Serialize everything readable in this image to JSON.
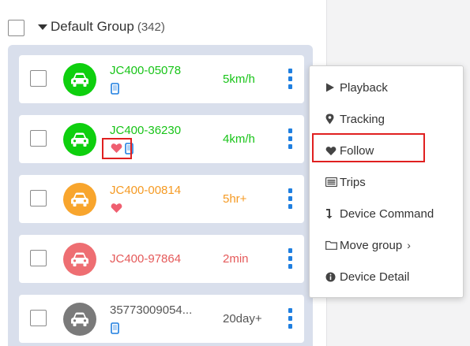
{
  "group": {
    "name": "Default Group",
    "count": "(342)"
  },
  "devices": [
    {
      "name": "JC400-05078",
      "status": "5km/h",
      "color": "#18c418",
      "avatar_color": "#0ecf0e",
      "icons": [
        "phone-icon"
      ]
    },
    {
      "name": "JC400-36230",
      "status": "4km/h",
      "color": "#18c418",
      "avatar_color": "#0ecf0e",
      "icons": [
        "heart-icon",
        "phone-icon"
      ]
    },
    {
      "name": "JC400-00814",
      "status": "5hr+",
      "color": "#f59a23",
      "avatar_color": "#f8a52d",
      "icons": [
        "heart-icon"
      ]
    },
    {
      "name": "JC400-97864",
      "status": "2min",
      "color": "#e55a5a",
      "avatar_color": "#ee6e72",
      "icons": []
    },
    {
      "name": "35773009054...",
      "status": "20day+",
      "color": "#555555",
      "avatar_color": "#7a7a7a",
      "icons": [
        "phone-icon"
      ]
    }
  ],
  "menu": {
    "items": [
      {
        "label": "Playback",
        "icon": "play-icon"
      },
      {
        "label": "Tracking",
        "icon": "map-marker-icon"
      },
      {
        "label": "Follow",
        "icon": "heart-icon"
      },
      {
        "label": "Trips",
        "icon": "list-icon"
      },
      {
        "label": "Device Command",
        "icon": "command-arrow-icon"
      },
      {
        "label": "Move group",
        "icon": "folder-icon",
        "submenu": "›"
      },
      {
        "label": "Device Detail",
        "icon": "info-circle-icon"
      }
    ]
  },
  "colors": {
    "accent_blue": "#1f7fe0",
    "heart": "#ef5f70",
    "highlight": "#e02020",
    "panel": "#d9dfec"
  }
}
